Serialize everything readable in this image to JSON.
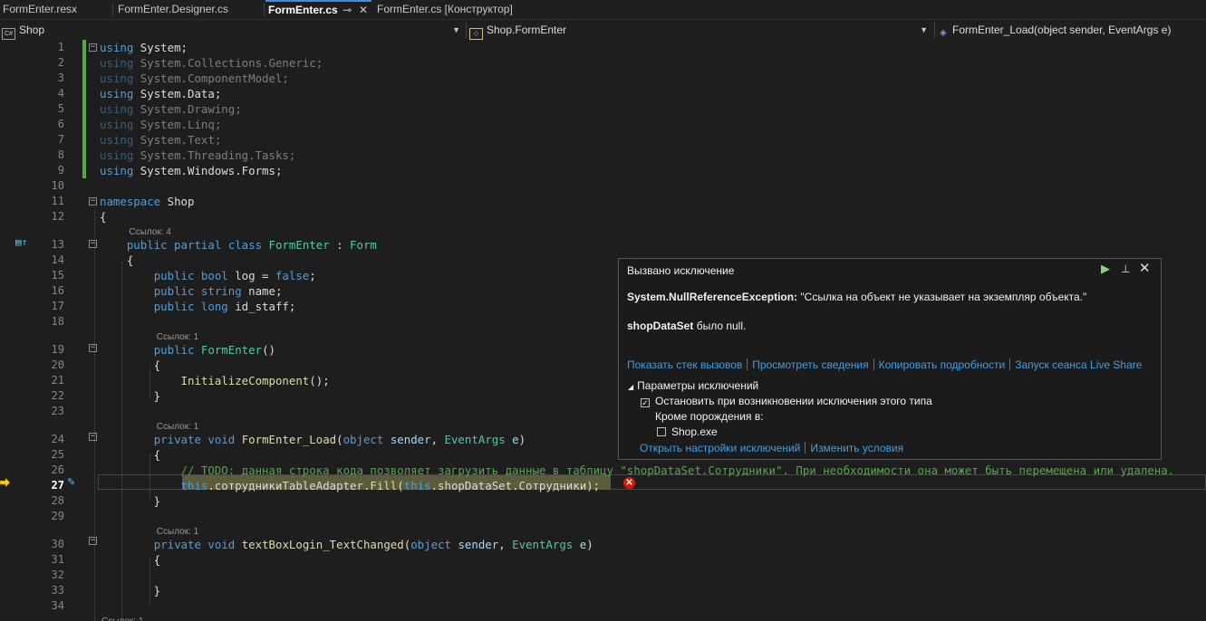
{
  "tabs": [
    {
      "label": "FormEnter.resx"
    },
    {
      "label": "FormEnter.Designer.cs"
    },
    {
      "label": "FormEnter.cs",
      "active": true
    },
    {
      "label": "FormEnter.cs [Конструктор]"
    }
  ],
  "navbar": {
    "project": "Shop",
    "class": "Shop.FormEnter",
    "member": "FormEnter_Load(object sender, EventArgs e)"
  },
  "editor": {
    "current_line": 27,
    "lines": [
      {
        "n": "1",
        "code": [
          [
            "kw",
            "using"
          ],
          [
            "",
            "System;"
          ]
        ]
      },
      {
        "n": "2",
        "code": [
          [
            "kw dim",
            "using"
          ],
          [
            "dim",
            " System.Collections.Generic;"
          ]
        ]
      },
      {
        "n": "3",
        "code": [
          [
            "kw dim",
            "using"
          ],
          [
            "dim",
            " System.ComponentModel;"
          ]
        ]
      },
      {
        "n": "4",
        "code": [
          [
            "kw",
            "using"
          ],
          [
            "",
            "System.Data;"
          ]
        ]
      },
      {
        "n": "5",
        "code": [
          [
            "kw dim",
            "using"
          ],
          [
            "dim",
            " System.Drawing;"
          ]
        ]
      },
      {
        "n": "6",
        "code": [
          [
            "kw dim",
            "using"
          ],
          [
            "dim",
            " System.Linq;"
          ]
        ]
      },
      {
        "n": "7",
        "code": [
          [
            "kw dim",
            "using"
          ],
          [
            "dim",
            " System.Text;"
          ]
        ]
      },
      {
        "n": "8",
        "code": [
          [
            "kw dim",
            "using"
          ],
          [
            "dim",
            " System.Threading.Tasks;"
          ]
        ]
      },
      {
        "n": "9",
        "code": [
          [
            "kw",
            "using"
          ],
          [
            "",
            "System.Windows.Forms;"
          ]
        ]
      },
      {
        "n": "10",
        "code": []
      },
      {
        "n": "11",
        "code": [
          [
            "kw",
            "namespace"
          ],
          [
            "",
            "Shop"
          ]
        ]
      },
      {
        "n": "12",
        "code": [
          [
            "",
            "{"
          ]
        ]
      },
      {
        "n": "13",
        "lens": "Ссылок: 4",
        "code": [
          [
            "",
            "    "
          ],
          [
            "kw",
            "public partial class"
          ],
          [
            "",
            " "
          ],
          [
            "ty",
            "FormEnter"
          ],
          [
            "",
            " : "
          ],
          [
            "ty",
            "Form"
          ]
        ]
      },
      {
        "n": "14",
        "code": [
          [
            "",
            "    {"
          ]
        ]
      },
      {
        "n": "15",
        "code": [
          [
            "",
            "        "
          ],
          [
            "kw",
            "public bool"
          ],
          [
            "",
            " log = "
          ],
          [
            "kw",
            "false"
          ],
          [
            "",
            ";"
          ]
        ]
      },
      {
        "n": "16",
        "code": [
          [
            "",
            "        "
          ],
          [
            "kw",
            "public string"
          ],
          [
            "",
            " name;"
          ]
        ]
      },
      {
        "n": "17",
        "code": [
          [
            "",
            "        "
          ],
          [
            "kw",
            "public long"
          ],
          [
            "",
            " id_staff;"
          ]
        ]
      },
      {
        "n": "18",
        "code": []
      },
      {
        "n": "19",
        "lens": "Ссылок: 1",
        "code": [
          [
            "",
            "        "
          ],
          [
            "kw",
            "public"
          ],
          [
            "",
            " "
          ],
          [
            "ty",
            "FormEnter"
          ],
          [
            "",
            "()"
          ]
        ]
      },
      {
        "n": "20",
        "code": [
          [
            "",
            "        {"
          ]
        ]
      },
      {
        "n": "21",
        "code": [
          [
            "",
            "            "
          ],
          [
            "fn",
            "InitializeComponent"
          ],
          [
            "",
            "();"
          ]
        ]
      },
      {
        "n": "22",
        "code": [
          [
            "",
            "        }"
          ]
        ]
      },
      {
        "n": "23",
        "code": []
      },
      {
        "n": "24",
        "lens": "Ссылок: 1",
        "code": [
          [
            "",
            "        "
          ],
          [
            "kw",
            "private void"
          ],
          [
            "",
            " "
          ],
          [
            "fn",
            "FormEnter_Load"
          ],
          [
            "",
            "("
          ],
          [
            "kw",
            "object"
          ],
          [
            "",
            " "
          ],
          [
            "pm",
            "sender"
          ],
          [
            "",
            ", "
          ],
          [
            "ty",
            "EventArgs"
          ],
          [
            "",
            " "
          ],
          [
            "pm",
            "e"
          ],
          [
            "",
            ")"
          ]
        ]
      },
      {
        "n": "25",
        "code": [
          [
            "",
            "        {"
          ]
        ]
      },
      {
        "n": "26",
        "code": [
          [
            "",
            "            "
          ],
          [
            "cm",
            "// TODO: данная строка кода позволяет загрузить данные в таблицу \"shopDataSet.Сотрудники\". При необходимости она может быть перемещена или удалена."
          ]
        ]
      },
      {
        "n": "27",
        "code": [
          [
            "",
            "            "
          ],
          [
            "kw",
            "this"
          ],
          [
            "",
            ".сотрудникиTableAdapter."
          ],
          [
            "fn",
            "Fill"
          ],
          [
            "",
            "("
          ],
          [
            "kw",
            "this"
          ],
          [
            "",
            ".shopDataSet.Сотрудники);"
          ]
        ]
      },
      {
        "n": "28",
        "code": [
          [
            "",
            "        }"
          ]
        ]
      },
      {
        "n": "29",
        "code": []
      },
      {
        "n": "30",
        "lens": "Ссылок: 1",
        "code": [
          [
            "",
            "        "
          ],
          [
            "kw",
            "private void"
          ],
          [
            "",
            " "
          ],
          [
            "fn",
            "textBoxLogin_TextChanged"
          ],
          [
            "",
            "("
          ],
          [
            "kw",
            "object"
          ],
          [
            "",
            " "
          ],
          [
            "pm",
            "sender"
          ],
          [
            "",
            ", "
          ],
          [
            "ty",
            "EventArgs"
          ],
          [
            "",
            " "
          ],
          [
            "pm",
            "e"
          ],
          [
            "",
            ")"
          ]
        ]
      },
      {
        "n": "31",
        "code": [
          [
            "",
            "        {"
          ]
        ]
      },
      {
        "n": "32",
        "code": []
      },
      {
        "n": "33",
        "code": [
          [
            "",
            "        }"
          ]
        ]
      },
      {
        "n": "34",
        "code": []
      },
      {
        "n": "",
        "lens": "Ссылок: 1",
        "code": []
      }
    ]
  },
  "exception_popup": {
    "title": "Вызвано исключение",
    "exception_type": "System.NullReferenceException:",
    "exception_message": " \"Ссылка на объект не указывает на экземпляр объекта.\"",
    "detail_var": "shopDataSet",
    "detail_text": " было null.",
    "links": [
      "Показать стек вызовов",
      "Просмотреть сведения",
      "Копировать подробности",
      "Запуск сеанса Live Share"
    ],
    "settings_header": "Параметры исключений",
    "break_when_thrown": "Остановить при возникновении исключения этого типа",
    "break_when_thrown_checked": true,
    "except_thrown_from": "Кроме порождения в:",
    "module": "Shop.exe",
    "module_checked": false,
    "bottom_links": [
      "Открыть настройки исключений",
      "Изменить условия"
    ]
  }
}
